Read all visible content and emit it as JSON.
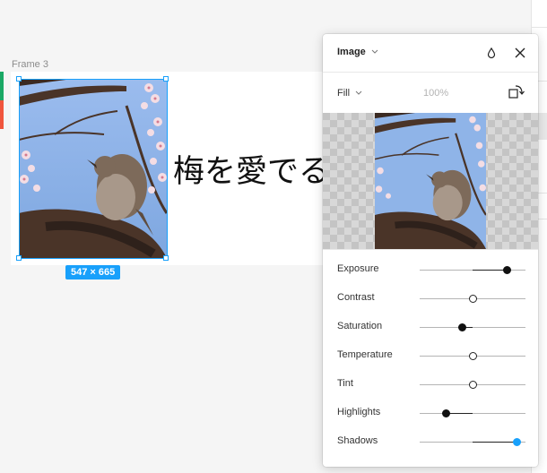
{
  "frame": {
    "label": "Frame 3",
    "text": "梅を愛でる",
    "selection_size": "547 × 665"
  },
  "popup": {
    "title": "Image",
    "fill_mode": "Fill",
    "opacity": "100%"
  },
  "adjustments": [
    {
      "label": "Exposure",
      "value": 0.33,
      "state": "active"
    },
    {
      "label": "Contrast",
      "value": 0.0,
      "state": "neutral"
    },
    {
      "label": "Saturation",
      "value": -0.1,
      "state": "active"
    },
    {
      "label": "Temperature",
      "value": 0.0,
      "state": "neutral"
    },
    {
      "label": "Tint",
      "value": 0.0,
      "state": "neutral"
    },
    {
      "label": "Highlights",
      "value": -0.25,
      "state": "active"
    },
    {
      "label": "Shadows",
      "value": 0.42,
      "state": "focused"
    }
  ],
  "colors": {
    "selection": "#18a0fb",
    "strip_green": "#1aa865",
    "strip_red": "#f0553d",
    "sky": "#8fb4e8"
  },
  "icons": [
    "chevron-down-icon",
    "drop-icon",
    "close-icon",
    "rotate-icon"
  ]
}
